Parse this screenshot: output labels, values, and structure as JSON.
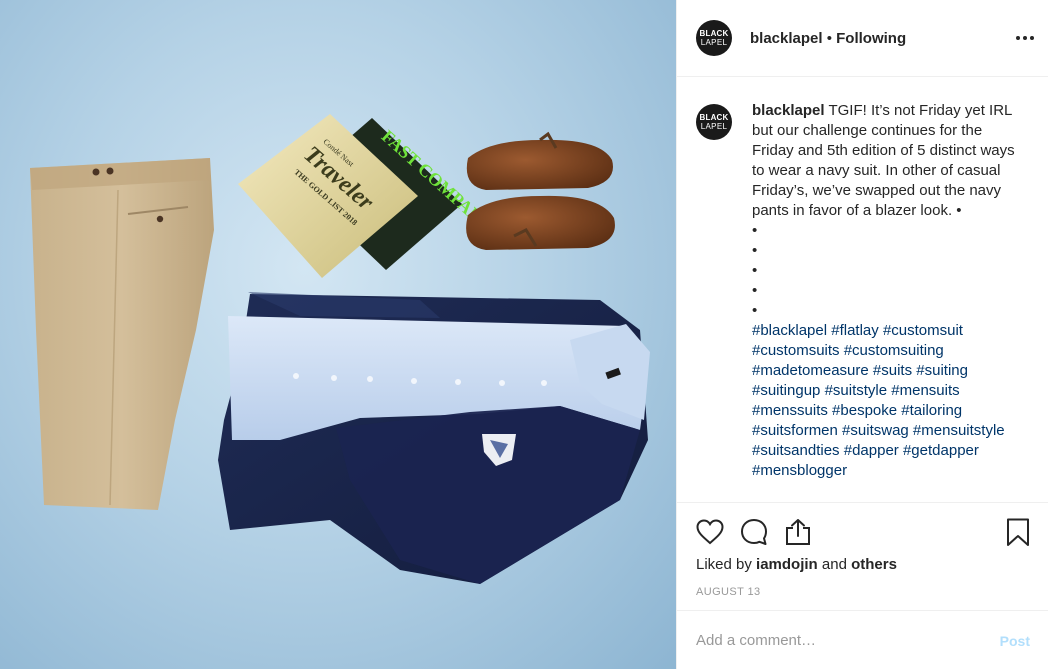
{
  "post": {
    "photo_alt": "",
    "magazine_1": {
      "line1": "Condé Nast",
      "line2": "Traveler",
      "line3": "THE GOLD LIST 2018"
    },
    "magazine_2": {
      "line1": "FAST COMPANY"
    }
  },
  "header": {
    "avatar_top": "BLACK",
    "avatar_bottom": "LAPEL",
    "username": "blacklapel",
    "separator": " • ",
    "follow_status": "Following"
  },
  "caption": {
    "username": "blacklapel",
    "text": "TGIF! It’s not Friday yet IRL but our challenge continues for the Friday and 5th edition of 5 distinct ways to wear a navy suit. In other of casual Friday’s, we’ve swapped out the navy pants in favor of a blazer look. •",
    "dots": [
      "•",
      "•",
      "•",
      "•",
      "•"
    ],
    "hashtags": [
      "#blacklapel",
      "#flatlay",
      "#customsuit",
      "#customsuits",
      "#customsuiting",
      "#madetomeasure",
      "#suits",
      "#suiting",
      "#suitingup",
      "#suitstyle",
      "#mensuits",
      "#menssuits",
      "#bespoke",
      "#tailoring",
      "#suitsformen",
      "#suitswag",
      "#mensuitstyle",
      "#suitsandties",
      "#dapper",
      "#getdapper",
      "#mensblogger"
    ]
  },
  "actions": {
    "icons": [
      "heart-icon",
      "comment-icon",
      "share-icon",
      "bookmark-icon"
    ],
    "liked_by_prefix": "Liked by ",
    "liked_by_user": "iamdojin",
    "liked_by_and": " and ",
    "liked_by_others": "others",
    "date": "AUGUST 13"
  },
  "comment": {
    "placeholder": "Add a comment…",
    "post_label": "Post"
  },
  "colors": {
    "hashtag": "#003569",
    "post_disabled": "#b2dffc",
    "muted": "#999999",
    "text": "#262626"
  }
}
